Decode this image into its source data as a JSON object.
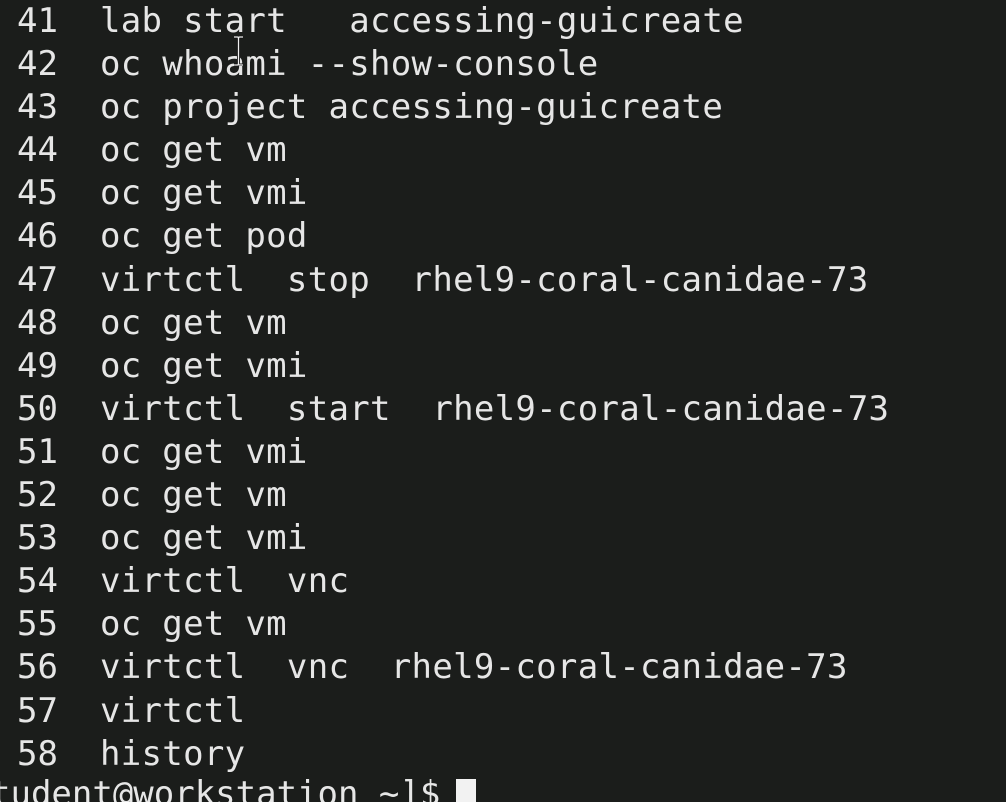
{
  "history": [
    {
      "num": "41",
      "cmd": "lab start   accessing-guicreate"
    },
    {
      "num": "42",
      "cmd": "oc whoami --show-console"
    },
    {
      "num": "43",
      "cmd": "oc project accessing-guicreate"
    },
    {
      "num": "44",
      "cmd": "oc get vm"
    },
    {
      "num": "45",
      "cmd": "oc get vmi"
    },
    {
      "num": "46",
      "cmd": "oc get pod"
    },
    {
      "num": "47",
      "cmd": "virtctl  stop  rhel9-coral-canidae-73"
    },
    {
      "num": "48",
      "cmd": "oc get vm"
    },
    {
      "num": "49",
      "cmd": "oc get vmi"
    },
    {
      "num": "50",
      "cmd": "virtctl  start  rhel9-coral-canidae-73"
    },
    {
      "num": "51",
      "cmd": "oc get vmi"
    },
    {
      "num": "52",
      "cmd": "oc get vm"
    },
    {
      "num": "53",
      "cmd": "oc get vmi"
    },
    {
      "num": "54",
      "cmd": "virtctl  vnc"
    },
    {
      "num": "55",
      "cmd": "oc get vm"
    },
    {
      "num": "56",
      "cmd": "virtctl  vnc  rhel9-coral-canidae-73"
    },
    {
      "num": "57",
      "cmd": "virtctl"
    },
    {
      "num": "58",
      "cmd": "history"
    }
  ],
  "prompt": "tudent@workstation ~]$",
  "colors": {
    "background": "#1b1d1b",
    "text": "#e6e6e6",
    "cursor": "#f2f2f2"
  },
  "icons": {
    "mouse_pointer": "text-ibeam-cursor-icon"
  }
}
